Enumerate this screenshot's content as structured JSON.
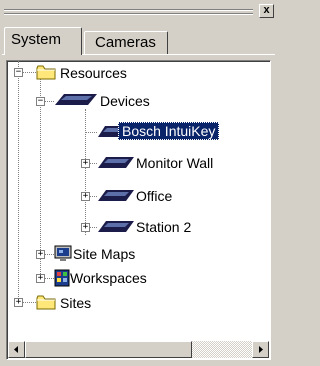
{
  "window": {
    "close_label": "x"
  },
  "tabs": [
    {
      "label": "System",
      "active": true
    },
    {
      "label": "Cameras",
      "active": false
    }
  ],
  "tree": {
    "resources": "Resources",
    "devices": "Devices",
    "bosch_intuikey": "Bosch IntuiKey",
    "monitor_wall": "Monitor Wall",
    "office": "Office",
    "station_2": "Station 2",
    "site_maps": "Site Maps",
    "workspaces": "Workspaces",
    "sites": "Sites",
    "expand_symbol": "+",
    "collapse_symbol": "−"
  },
  "colors": {
    "selection_bg": "#0a246a",
    "folder_yellow": "#ffe77a",
    "keyboard_dark": "#1c1c4a"
  },
  "icons": {
    "folder": "folder-icon",
    "keyboard": "keyboard-device-icon",
    "site_map": "site-map-icon",
    "workspace": "workspace-icon"
  }
}
